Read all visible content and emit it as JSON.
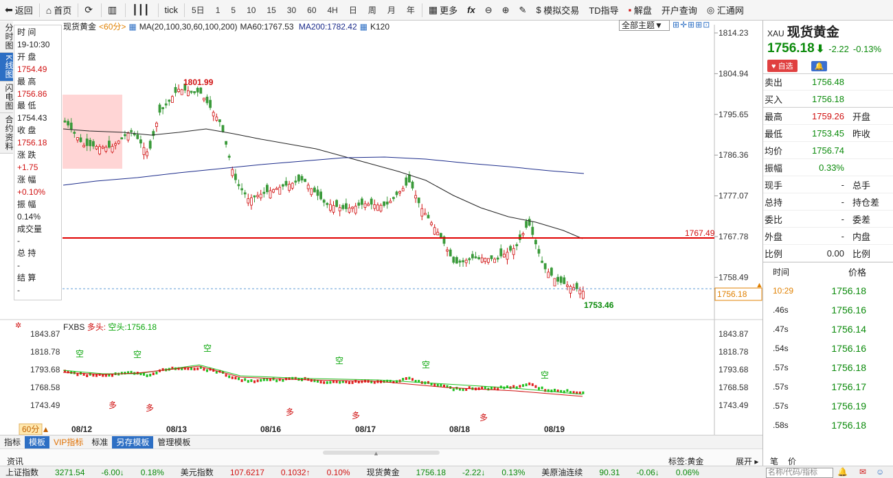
{
  "toolbar": {
    "back": "返回",
    "home": "首页",
    "tick": "tick",
    "periods": [
      "5日",
      "1",
      "5",
      "10",
      "15",
      "30",
      "60",
      "4H",
      "日",
      "周",
      "月",
      "年"
    ],
    "more": "更多",
    "sim_trade": "模拟交易",
    "td": "TD指导",
    "decode": "解盘",
    "open_account": "开户查询",
    "huitong": "汇通网"
  },
  "left_tabs": [
    "分时图",
    "K线图",
    "闪电图",
    "合约资料"
  ],
  "info": {
    "time_label": "时 间",
    "time_value": "19-10:30",
    "open_label": "开 盘",
    "open_value": "1754.49",
    "high_label": "最 高",
    "high_value": "1756.86",
    "low_label": "最 低",
    "low_value": "1754.43",
    "close_label": "收 盘",
    "close_value": "1756.18",
    "change_label": "涨 跌",
    "change_value": "+1.75",
    "pct_label": "涨 幅",
    "pct_value": "+0.10%",
    "amp_label": "振 幅",
    "amp_value": "0.14%",
    "vol_label": "成交量",
    "vol_value": "-",
    "hold_label": "总 持",
    "hold_value": "-",
    "settle_label": "结 算",
    "settle_value": "-"
  },
  "legend": {
    "name": "现货黄金",
    "period": "<60分>",
    "ma": "MA(20,100,30,60,100,200)",
    "ma60": "MA60:1767.53",
    "ma200": "MA200:1782.42",
    "k": "K120"
  },
  "theme_label": "全部主题▼",
  "main_axis": [
    "1814.23",
    "1804.94",
    "1795.65",
    "1786.36",
    "1777.07",
    "1767.78",
    "1758.49"
  ],
  "hline_label": "1767.49",
  "last_price_box": "1756.18",
  "high_marker": "1801.99",
  "low_marker": "1753.46",
  "sub_legend": {
    "name": "FXBS",
    "long": "多头:",
    "short": "空头:1756.18"
  },
  "sub_axis": [
    "1843.87",
    "1818.78",
    "1793.68",
    "1768.58",
    "1743.49"
  ],
  "sub_signals": {
    "kong": "空",
    "duo": "多"
  },
  "dates": [
    "08/12",
    "08/13",
    "08/16",
    "08/17",
    "08/18",
    "08/19"
  ],
  "period_select": "60分 ▲",
  "bottom_tabs": [
    "指标",
    "模板",
    "VIP指标",
    "标准",
    "另存模板",
    "管理模板"
  ],
  "news": {
    "label": "资讯",
    "tag": "标签:黄金",
    "expand": "展开 ▸"
  },
  "ticker": [
    {
      "name": "上证指数",
      "v": "3271.54",
      "c": "-6.00↓",
      "p": "0.18%",
      "cls": "g"
    },
    {
      "name": "美元指数",
      "v": "107.6217",
      "c": "0.1032↑",
      "p": "0.10%",
      "cls": "r"
    },
    {
      "name": "现货黄金",
      "v": "1756.18",
      "c": "-2.22↓",
      "p": "0.13%",
      "cls": "g"
    },
    {
      "name": "美原油连续",
      "v": "90.31",
      "c": "-0.06↓",
      "p": "0.06%",
      "cls": "g"
    }
  ],
  "quote": {
    "symbol": "XAU",
    "name": "现货黄金",
    "price": "1756.18",
    "arrow": "⬇",
    "change": "-2.22",
    "pct": "-0.13%",
    "watch": "♥ 自选",
    "bell": "🔔",
    "sell_label": "卖出",
    "sell": "1756.48",
    "buy_label": "买入",
    "buy": "1756.18",
    "rows": [
      {
        "k": "最高",
        "v": "1759.26",
        "vcls": "r",
        "k2": "开盘",
        "v2": ""
      },
      {
        "k": "最低",
        "v": "1753.45",
        "vcls": "g",
        "k2": "昨收",
        "v2": ""
      },
      {
        "k": "均价",
        "v": "1756.74",
        "vcls": "g",
        "k2": "",
        "v2": ""
      },
      {
        "k": "振幅",
        "v": "0.33%",
        "vcls": "g",
        "k2": "",
        "v2": ""
      },
      {
        "k": "现手",
        "v": "-",
        "vcls": "",
        "k2": "总手",
        "v2": ""
      },
      {
        "k": "总持",
        "v": "-",
        "vcls": "",
        "k2": "持仓差",
        "v2": ""
      },
      {
        "k": "委比",
        "v": "-",
        "vcls": "",
        "k2": "委差",
        "v2": ""
      },
      {
        "k": "外盘",
        "v": "-",
        "vcls": "",
        "k2": "内盘",
        "v2": ""
      },
      {
        "k": "比例",
        "v": "0.00",
        "vcls": "",
        "k2": "比例",
        "v2": ""
      }
    ],
    "ticks_header": [
      "时间",
      "价格"
    ],
    "ticks": [
      {
        "t": "10:29",
        "p": "1756.18"
      },
      {
        "t": ".46s",
        "p": "1756.16"
      },
      {
        "t": ".47s",
        "p": "1756.14"
      },
      {
        "t": ".54s",
        "p": "1756.16"
      },
      {
        "t": ".57s",
        "p": "1756.18"
      },
      {
        "t": ".57s",
        "p": "1756.17"
      },
      {
        "t": ".57s",
        "p": "1756.19"
      },
      {
        "t": ".58s",
        "p": "1756.18"
      }
    ],
    "foot": [
      "笔",
      "价"
    ]
  },
  "search_placeholder": "名称/代码/指标"
}
